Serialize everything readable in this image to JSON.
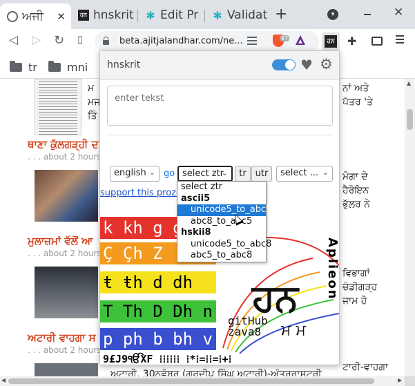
{
  "tabs": [
    {
      "title": "ਅਜੀ",
      "favicon": "globe-icon",
      "active": true
    },
    {
      "title": "hnskrit",
      "favicon": "hnskrit-icon",
      "active": false
    },
    {
      "title": "Edit Pr",
      "favicon": "teal-star-icon",
      "active": false
    },
    {
      "title": "Validat",
      "favicon": "teal-star-icon",
      "active": false
    }
  ],
  "tab_close_glyph": "✕",
  "new_tab_glyph": "+",
  "window": {
    "close_glyph": "✕"
  },
  "toolbar": {
    "url": "beta.ajitjalandhar.com/ne...",
    "brave_badge": "97",
    "ext_label": "ਹਨ"
  },
  "bookmarks": [
    {
      "label": "tr"
    },
    {
      "label": "mni"
    }
  ],
  "page": {
    "headlines": [
      "ਥਾਣਾ ਕੁੱਲਗੜ੍ਹੀ ਦ",
      "ਮੁਲਾਜ਼ਮਾਂ ਵੱਲੋਂ ਆ",
      "ਅਟਾਰੀ ਵਾਹਗਾ ਸ"
    ],
    "meta": [
      ". . . about 2 hours",
      ". . . about 2 hours",
      ". . . about 2 hours"
    ],
    "snippets_left": [
      "ਮ",
      "ਮਜ",
      "ਤਿੰ"
    ],
    "snippets_right": [
      "ਨਾਂ ਅਤੇ",
      "ਪੱਤਰ 'ਤੇ",
      "ਮੋਗਾ ਦੇ",
      "ਹੈਰੋਇਨ",
      "ਭੁੱਲਰ ਨੇ",
      "ਵਿਭਾਗਾਂ",
      "ਚੰਡੀਗੜ੍ਹ",
      "ਜਾਮ ਹੋ",
      "ਟਾਰੀ-ਵਾਹਗਾ",
      "ਅਟਾਰੀ,  30ਨਵੰਬਰ  (ਗੁਰਦੀਪ  ਸਿੰਘ  ਅਟਾਰੀ)-ਅੰਤਰਰਾਸ਼ਟਰੀ"
    ]
  },
  "popup": {
    "title": "hnskrit",
    "toggle_on": true,
    "input_placeholder": "enter tekst",
    "language_select": "english",
    "go_label": "go",
    "ztr_select": "select ztr",
    "tr_button": "tr",
    "utr_button": "utr",
    "third_select": "select ...",
    "support_link": "support this prozekt",
    "dropdown_options": [
      {
        "label": "select ztr",
        "type": "option"
      },
      {
        "label": "ascii5",
        "type": "group"
      },
      {
        "label": "unicode5_to_abc5",
        "type": "option",
        "selected": true
      },
      {
        "label": "abc8_to_abc5",
        "type": "option"
      },
      {
        "label": "hskii8",
        "type": "group"
      },
      {
        "label": "unicode5_to_abc8",
        "type": "option"
      },
      {
        "label": "abc5_to_abc8",
        "type": "option"
      }
    ],
    "logo": {
      "bands": [
        {
          "text": "k kh g g",
          "color": "#e5322d"
        },
        {
          "text": "Ç Çh Z",
          "color": "#f39a1f"
        },
        {
          "text": "ŧ ŧh d dh",
          "color": "#f6e21c"
        },
        {
          "text": "T Th D Dh n",
          "color": "#3ec23a"
        },
        {
          "text": "p ph b bh v m",
          "color": "#3a4fd0"
        }
      ],
      "bottom_row": "9£J9ੴXF ⁞⁞⁞⁞⁞⁞ ⁞*⁞=⁞⁞=⁞+⁞",
      "vertical_text": "Aplieon",
      "big_glyph": "ਹਨ",
      "github_text": "gitHub\nzava8",
      "small_glyph": "ਮ ਮ"
    }
  },
  "colors": {
    "accent": "#1a73e8",
    "headline": "#d2431e",
    "dropdown_selected": "#1e7ad6"
  }
}
